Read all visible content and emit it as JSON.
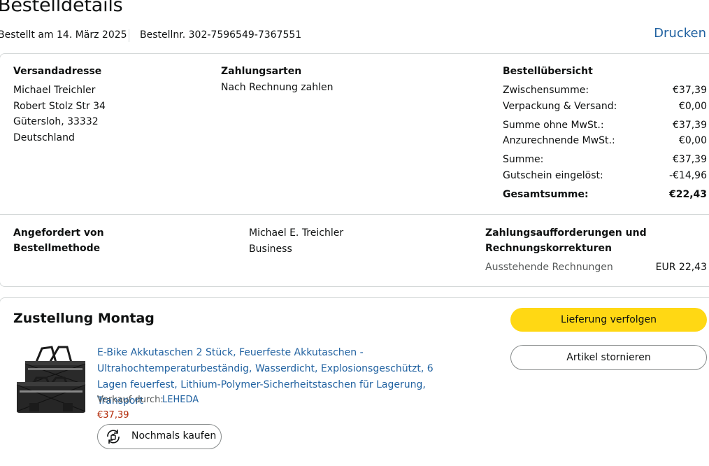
{
  "header": {
    "title": "Bestelldetails",
    "ordered_on": "Bestellt am 14. März 2025",
    "order_number": "Bestellnr. 302-7596549-7367551",
    "print_link": "Drucken"
  },
  "shipping": {
    "heading": "Versandadresse",
    "lines": [
      "Michael Treichler",
      "Robert Stolz Str 34",
      "Gütersloh, 33332",
      "Deutschland"
    ]
  },
  "payment": {
    "heading": "Zahlungsarten",
    "method": "Nach Rechnung zahlen"
  },
  "summary": {
    "heading": "Bestellübersicht",
    "rows": [
      {
        "label": "Zwischensumme:",
        "value": "€37,39"
      },
      {
        "label": "Verpackung & Versand:",
        "value": "€0,00"
      },
      {
        "label": "Summe ohne MwSt.:",
        "value": "€37,39"
      },
      {
        "label": "Anzurechnende MwSt.:",
        "value": "€0,00"
      },
      {
        "label": "Summe:",
        "value": "€37,39"
      },
      {
        "label": "Gutschein eingelöst:",
        "value": "-€14,96"
      }
    ],
    "total_label": "Gesamtsumme:",
    "total_value": "€22,43"
  },
  "requested": {
    "label_line1": "Angefordert von",
    "label_line2": "Bestellmethode",
    "value_line1": "Michael E. Treichler",
    "value_line2": "Business"
  },
  "invoices": {
    "heading_line1": "Zahlungsaufforderungen und",
    "heading_line2": "Rechnungskorrekturen",
    "outstanding_label": "Ausstehende Rechnungen",
    "outstanding_value": "EUR 22,43"
  },
  "delivery": {
    "heading": "Zustellung Montag",
    "track_button": "Lieferung verfolgen",
    "cancel_button": "Artikel stornieren",
    "product": {
      "title": "E-Bike Akkutaschen 2 Stück, Feuerfeste Akkutaschen - Ultrahochtemperaturbeständig, Wasserdicht, Explosionsgeschützt, 6 Lagen feuerfest, Lithium-Polymer-Sicherheitstaschen für Lagerung, Transport",
      "sold_by_label": "Verkauf durch:",
      "seller": "LEHEDA",
      "price": "€37,39",
      "buy_again": "Nochmals kaufen",
      "buy_again_icon": "rebuy-icon"
    }
  },
  "colors": {
    "link": "#2162a1",
    "primary_button": "#ffd814",
    "price": "#b12704",
    "border": "#d5d9d9"
  }
}
